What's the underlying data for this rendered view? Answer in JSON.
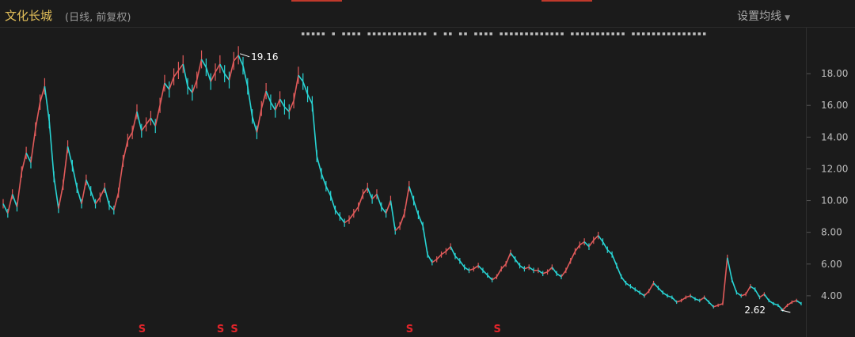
{
  "header": {
    "title": "文化长城",
    "subtitle": "(日线, 前复权)",
    "settings_label": "设置均线"
  },
  "legend_text": "▪▪▪▪▪  ▪  ▪▪▪▪  ▪▪▪▪▪▪▪▪▪▪▪▪  ▪  ▪▪  ▪▪  ▪▪▪▪  ▪▪▪▪▪▪▪▪▪▪▪▪▪  ▪▪▪▪▪▪▪▪▪▪▪  ▪▪▪▪▪▪▪▪▪▪▪▪▪▪▪",
  "colors": {
    "up": "#e05a5a",
    "down": "#28d4d4",
    "background": "#1b1b1b",
    "title": "#e5c15a",
    "marker": "#e0242a"
  },
  "chart_data": {
    "type": "line",
    "title": "文化长城",
    "subtitle": "(日线, 前复权)",
    "ylim": [
      2.0,
      19.8
    ],
    "y_ticks": [
      "18.00",
      "16.00",
      "14.00",
      "12.00",
      "10.00",
      "8.00",
      "6.00",
      "4.00"
    ],
    "y_tick_values": [
      18,
      16,
      14,
      12,
      10,
      8,
      6,
      4
    ],
    "series": [
      {
        "values": [
          9.8,
          9.2,
          10.4,
          9.6,
          11.8,
          13.0,
          12.4,
          14.5,
          16.2,
          17.2,
          15.0,
          11.5,
          9.5,
          11.0,
          13.4,
          12.2,
          10.8,
          9.8,
          11.3,
          10.6,
          9.8,
          10.2,
          10.8,
          9.7,
          9.4,
          10.5,
          12.5,
          13.8,
          14.3,
          15.6,
          14.4,
          14.8,
          15.2,
          14.7,
          16.0,
          17.4,
          17.0,
          17.8,
          18.2,
          18.6,
          17.2,
          16.8,
          17.6,
          18.9,
          18.4,
          17.5,
          18.1,
          18.6,
          18.0,
          17.6,
          18.8,
          19.16,
          18.5,
          17.2,
          15.3,
          14.3,
          15.8,
          16.9,
          16.2,
          15.7,
          16.4,
          15.9,
          15.6,
          16.3,
          17.9,
          17.5,
          16.7,
          16.1,
          12.8,
          11.7,
          10.9,
          10.3,
          9.4,
          9.0,
          8.6,
          8.8,
          9.2,
          9.6,
          10.4,
          10.8,
          10.1,
          10.4,
          9.6,
          9.2,
          10.0,
          8.1,
          8.4,
          9.2,
          10.9,
          10.0,
          9.1,
          8.4,
          6.6,
          6.1,
          6.3,
          6.6,
          6.8,
          7.1,
          6.5,
          6.2,
          5.8,
          5.6,
          5.7,
          5.9,
          5.6,
          5.3,
          5.0,
          5.2,
          5.7,
          6.0,
          6.7,
          6.3,
          5.9,
          5.7,
          5.8,
          5.6,
          5.6,
          5.4,
          5.5,
          5.8,
          5.4,
          5.2,
          5.6,
          6.2,
          6.8,
          7.2,
          7.4,
          7.1,
          7.5,
          7.8,
          7.4,
          6.9,
          6.6,
          5.9,
          5.2,
          4.8,
          4.6,
          4.4,
          4.2,
          4.0,
          4.3,
          4.8,
          4.5,
          4.2,
          4.0,
          3.9,
          3.6,
          3.7,
          3.9,
          4.0,
          3.8,
          3.7,
          3.9,
          3.6,
          3.3,
          3.4,
          3.5,
          6.4,
          5.0,
          4.2,
          4.0,
          4.1,
          4.6,
          4.4,
          3.9,
          4.1,
          3.7,
          3.5,
          3.4,
          3.1,
          3.4,
          3.6,
          3.7,
          3.5
        ]
      }
    ],
    "annotations": [
      {
        "text": "19.16",
        "index": 51
      },
      {
        "text": "2.62",
        "index": 171
      }
    ],
    "markers": [
      {
        "text": "S",
        "index": 30
      },
      {
        "text": "S",
        "index": 47
      },
      {
        "text": "S",
        "index": 50
      },
      {
        "text": "S",
        "index": 88
      },
      {
        "text": "S",
        "index": 107
      }
    ],
    "grid": false
  }
}
